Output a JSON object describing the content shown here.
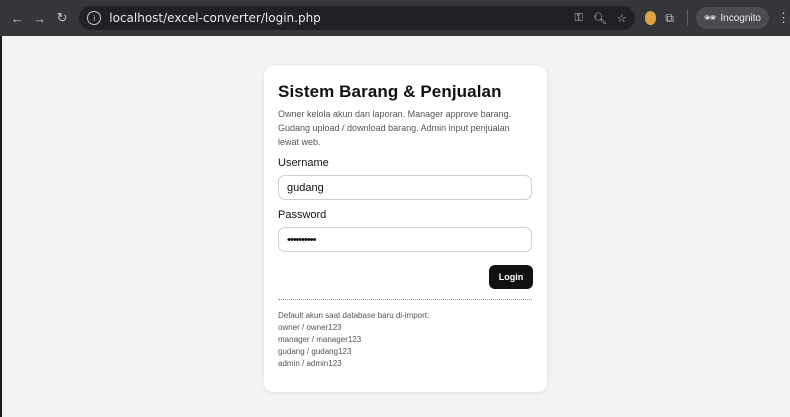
{
  "browser": {
    "url": "localhost/excel-converter/login.php",
    "incognito_label": "Incognito",
    "back_glyph": "←",
    "forward_glyph": "→",
    "reload_glyph": "↻",
    "menu_glyph": "⋮"
  },
  "login": {
    "title": "Sistem Barang & Penjualan",
    "description": "Owner kelola akun dan laporan. Manager approve barang. Gudang upload / download barang. Admin input penjualan lewat web.",
    "username_label": "Username",
    "username_value": "gudang",
    "password_label": "Password",
    "password_value": "••••••••••",
    "login_button": "Login",
    "info_heading": "Default akun saat database baru di-import:",
    "accounts": [
      "owner / owner123",
      "manager / manager123",
      "gudang / gudang123",
      "admin / admin123"
    ]
  }
}
